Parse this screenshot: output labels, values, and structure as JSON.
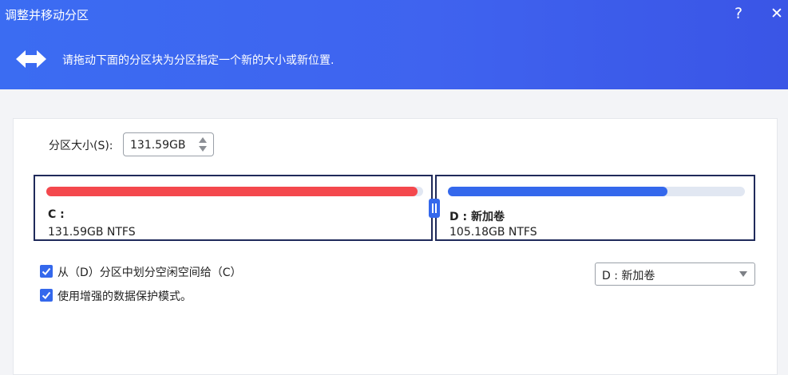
{
  "window": {
    "title": "调整并移动分区",
    "help_label": "?",
    "close_label": "✕"
  },
  "header": {
    "icon": "resize-arrows-icon",
    "instruction": "请拖动下面的分区块为分区指定一个新的大小或新位置."
  },
  "size": {
    "label": "分区大小(S):",
    "value": "131.59GB"
  },
  "partitions": [
    {
      "name": "C :",
      "info": "131.59GB NTFS",
      "used_fraction": 0.985,
      "color": "#f4484d"
    },
    {
      "name": "D : 新加卷",
      "info": "105.18GB NTFS",
      "used_fraction": 0.74,
      "color": "#3468ec"
    }
  ],
  "options": [
    {
      "label": "从（D）分区中划分空闲空间给（C）",
      "checked": true
    },
    {
      "label": "使用增强的数据保护模式。",
      "checked": true
    }
  ],
  "source_select": {
    "value": "D : 新加卷"
  },
  "colors": {
    "header": "#3f63ef",
    "accent": "#3468ec",
    "partition_border": "#1f2a5a"
  }
}
